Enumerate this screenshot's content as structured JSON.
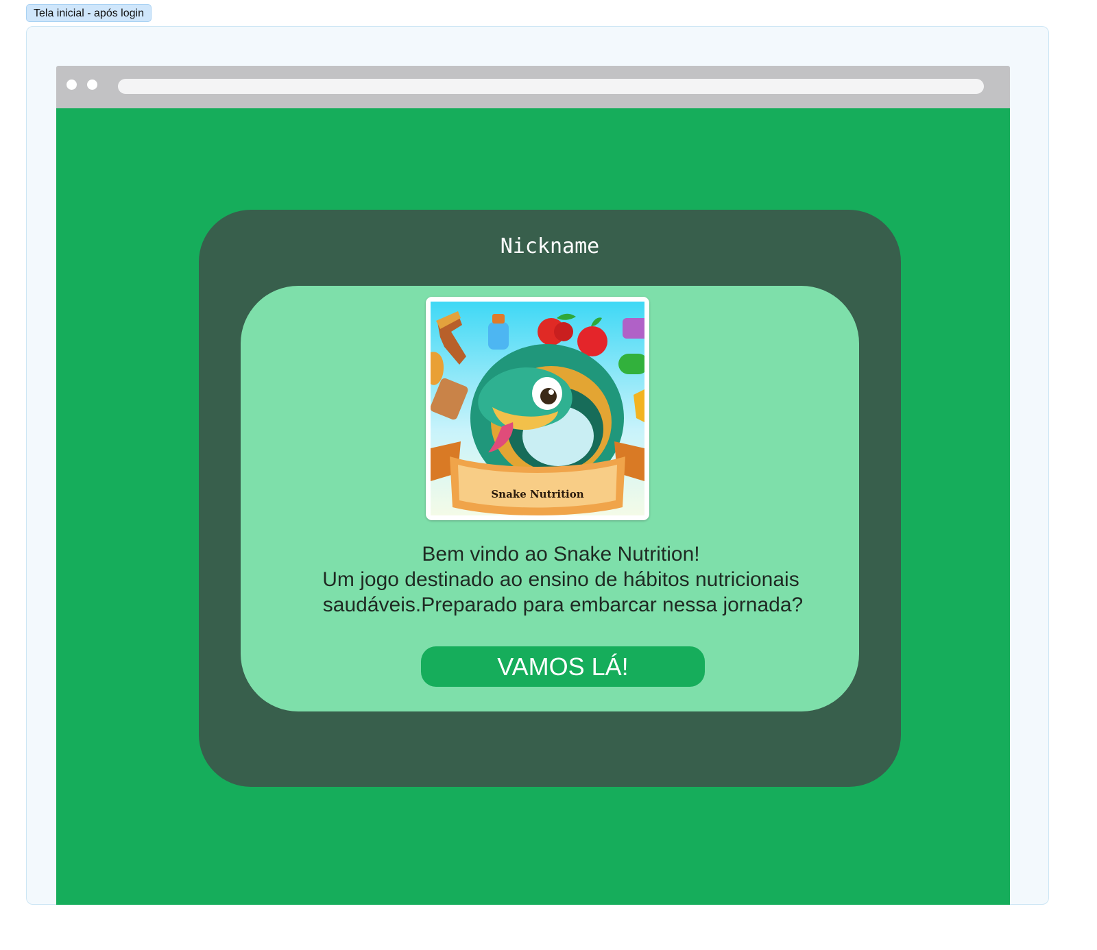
{
  "frame": {
    "label": "Tela inicial - após login"
  },
  "profile": {
    "nickname": "Nickname"
  },
  "logo": {
    "banner_text": "Snake Nutrition"
  },
  "welcome": {
    "line1": "Bem vindo ao Snake Nutrition!",
    "line2": "Um jogo destinado ao ensino de hábitos nutricionais",
    "line3": "saudáveis.Preparado para embarcar nessa jornada?"
  },
  "cta": {
    "label": "VAMOS LÁ!"
  },
  "colors": {
    "page_bg": "#16ad5b",
    "outer_panel": "#385f4c",
    "inner_card": "#7edfaa",
    "button": "#16ad5b",
    "browser_bar": "#c2c2c4"
  }
}
